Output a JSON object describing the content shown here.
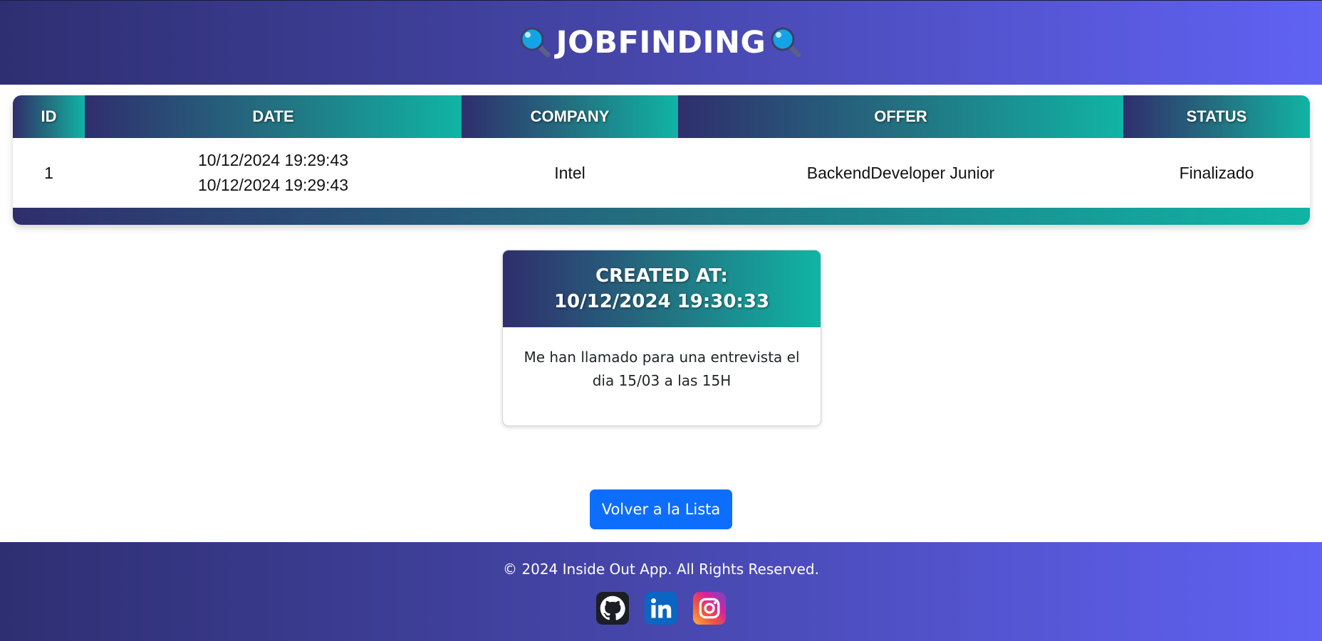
{
  "header": {
    "title": "JOBFINDING",
    "icon": "magnifying-glass-icon"
  },
  "table": {
    "columns": [
      "ID",
      "DATE",
      "COMPANY",
      "OFFER",
      "STATUS"
    ],
    "rows": [
      {
        "id": "1",
        "date_line1": "10/12/2024 19:29:43",
        "date_line2": "10/12/2024 19:29:43",
        "company": "Intel",
        "offer": "BackendDeveloper Junior",
        "status": "Finalizado"
      }
    ]
  },
  "note_card": {
    "title_line1": "CREATED AT:",
    "title_line2": "10/12/2024 19:30:33",
    "body": "Me han llamado para una entrevista el dia 15/03 a las 15H"
  },
  "back_button": {
    "label": "Volver a la Lista"
  },
  "footer": {
    "copyright": "© 2024 Inside Out App. All Rights Reserved.",
    "socials": [
      "github-icon",
      "linkedin-icon",
      "instagram-icon"
    ]
  },
  "colors": {
    "header_gradient": [
      "#2e2f72",
      "#6062f3"
    ],
    "table_gradient": [
      "#2f2e6d",
      "#10b4a5"
    ],
    "button": "#0d6efd"
  }
}
